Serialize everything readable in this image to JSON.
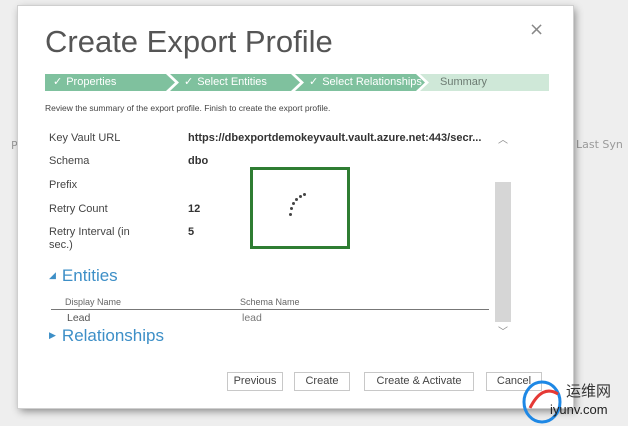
{
  "background": {
    "left_fragment": "P",
    "right_fragment": "Last Syn"
  },
  "dialog": {
    "title": "Create Export Profile",
    "close_glyph": "×",
    "steps": [
      {
        "label": "Properties",
        "check": "✓"
      },
      {
        "label": "Select Entities",
        "check": "✓"
      },
      {
        "label": "Select Relationships",
        "check": "✓"
      },
      {
        "label": "Summary",
        "check": ""
      }
    ],
    "instruction": "Review the summary of the export profile. Finish to create the export profile.",
    "fields": [
      {
        "label": "Key Vault URL",
        "value": "https://dbexportdemokeyvault.vault.azure.net:443/secr..."
      },
      {
        "label": "Schema",
        "value": "dbo"
      },
      {
        "label": "Prefix",
        "value": ""
      },
      {
        "label": "Retry Count",
        "value": "12"
      },
      {
        "label": "Retry Interval (in sec.)",
        "value": "5"
      }
    ],
    "entities_section": {
      "title": "Entities",
      "columns": [
        "Display Name",
        "Schema Name"
      ],
      "rows": [
        {
          "display_name": "Lead",
          "schema_name": "lead"
        }
      ]
    },
    "relationships_section": {
      "title": "Relationships"
    },
    "buttons": {
      "previous": "Previous",
      "create": "Create",
      "create_activate": "Create & Activate",
      "cancel": "Cancel"
    }
  },
  "watermark": {
    "chinese": "运维网",
    "domain": "iyunv.com"
  },
  "colors": {
    "step_active": "#7fc19e",
    "step_pending": "#cfe8d8",
    "section_heading": "#3d8fc7",
    "spinner_border": "#2e7d32"
  }
}
